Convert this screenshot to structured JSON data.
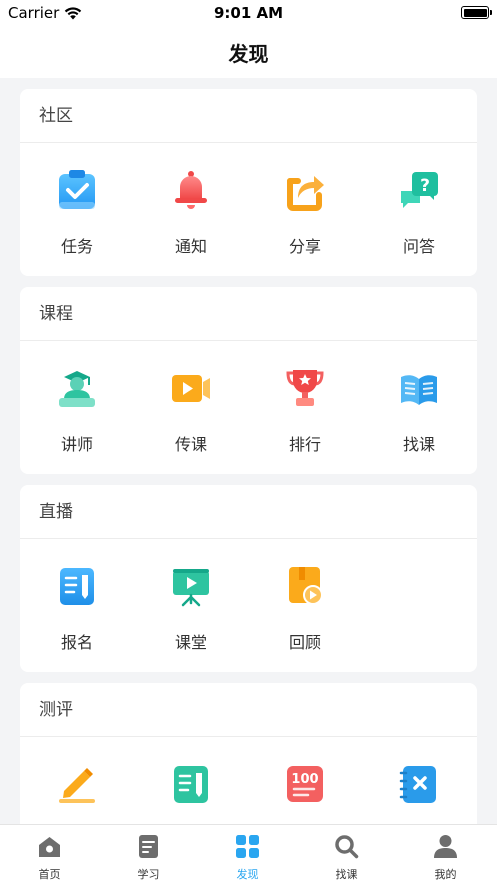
{
  "status_bar": {
    "carrier": "Carrier",
    "time": "9:01 AM"
  },
  "nav": {
    "title": "发现"
  },
  "sections": [
    {
      "title": "社区",
      "items": [
        {
          "label": "任务",
          "icon": "clipboard-check-icon"
        },
        {
          "label": "通知",
          "icon": "bell-icon"
        },
        {
          "label": "分享",
          "icon": "share-icon"
        },
        {
          "label": "问答",
          "icon": "question-chat-icon"
        }
      ]
    },
    {
      "title": "课程",
      "items": [
        {
          "label": "讲师",
          "icon": "teacher-icon"
        },
        {
          "label": "传课",
          "icon": "video-camera-icon"
        },
        {
          "label": "排行",
          "icon": "trophy-icon"
        },
        {
          "label": "找课",
          "icon": "book-icon"
        }
      ]
    },
    {
      "title": "直播",
      "items": [
        {
          "label": "报名",
          "icon": "signup-form-icon"
        },
        {
          "label": "课堂",
          "icon": "presentation-board-icon"
        },
        {
          "label": "回顾",
          "icon": "replay-book-icon"
        }
      ]
    },
    {
      "title": "测评",
      "items": [
        {
          "label": "",
          "icon": "pencil-edit-icon"
        },
        {
          "label": "",
          "icon": "exam-paper-icon"
        },
        {
          "label": "",
          "icon": "score-100-icon"
        },
        {
          "label": "",
          "icon": "wrong-notebook-icon"
        }
      ]
    }
  ],
  "tabs": [
    {
      "label": "首页",
      "icon": "home-icon",
      "active": false
    },
    {
      "label": "学习",
      "icon": "study-doc-icon",
      "active": false
    },
    {
      "label": "发现",
      "icon": "discover-grid-icon",
      "active": true
    },
    {
      "label": "找课",
      "icon": "search-icon",
      "active": false
    },
    {
      "label": "我的",
      "icon": "profile-icon",
      "active": false
    }
  ],
  "colors": {
    "accent": "#2aa6f0",
    "background": "#f3f4f6",
    "tab_inactive": "#6d6d6d"
  }
}
